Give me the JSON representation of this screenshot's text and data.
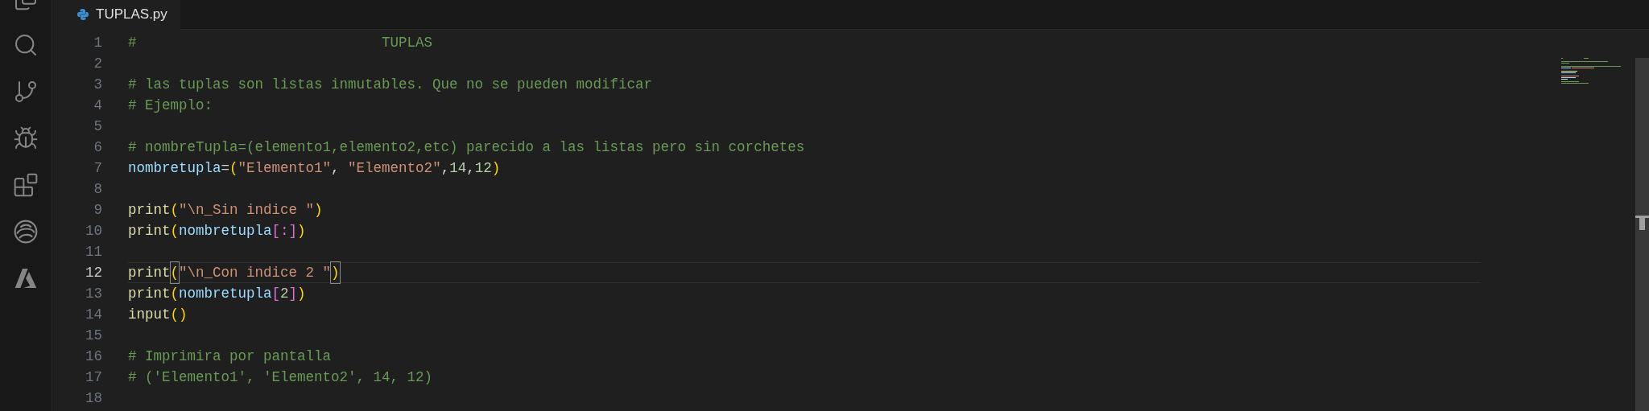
{
  "activity_bar": [
    {
      "kind": "files"
    },
    {
      "kind": "search"
    },
    {
      "kind": "source-control"
    },
    {
      "kind": "run-debug"
    },
    {
      "kind": "extensions"
    },
    {
      "kind": "swirl"
    },
    {
      "kind": "azure"
    }
  ],
  "tab": {
    "label": "TUPLAS.py",
    "selected": true
  },
  "lines": [
    {
      "number": "1",
      "selected": false,
      "tokens": [
        {
          "kind": "comment",
          "text": "#                             TUPLAS"
        }
      ]
    },
    {
      "number": "2",
      "selected": false
    },
    {
      "number": "3",
      "selected": false,
      "tokens": [
        {
          "kind": "comment",
          "text": "# las tuplas son listas inmutables. Que no se pueden modificar"
        }
      ]
    },
    {
      "number": "4",
      "selected": false,
      "tokens": [
        {
          "kind": "comment",
          "text": "# Ejemplo:"
        }
      ]
    },
    {
      "number": "5",
      "selected": false
    },
    {
      "number": "6",
      "selected": false,
      "tokens": [
        {
          "kind": "comment",
          "text": "# nombreTupla=(elemento1,elemento2,etc) parecido a las listas pero sin corchetes"
        }
      ]
    },
    {
      "number": "7",
      "selected": false,
      "tokens": [
        {
          "kind": "variable",
          "text": "nombretupla"
        },
        {
          "kind": "plain",
          "text": "="
        },
        {
          "kind": "bracket1",
          "text": "("
        },
        {
          "kind": "string",
          "text": "\"Elemento1\""
        },
        {
          "kind": "plain",
          "text": ", "
        },
        {
          "kind": "string",
          "text": "\"Elemento2\""
        },
        {
          "kind": "plain",
          "text": ","
        },
        {
          "kind": "number",
          "text": "14"
        },
        {
          "kind": "plain",
          "text": ","
        },
        {
          "kind": "number",
          "text": "12"
        },
        {
          "kind": "bracket1",
          "text": ")"
        }
      ]
    },
    {
      "number": "8",
      "selected": false
    },
    {
      "number": "9",
      "selected": false,
      "tokens": [
        {
          "kind": "function",
          "text": "print"
        },
        {
          "kind": "bracket1",
          "text": "("
        },
        {
          "kind": "string",
          "text": "\"\\n_Sin indice \""
        },
        {
          "kind": "bracket1",
          "text": ")"
        }
      ]
    },
    {
      "number": "10",
      "selected": false,
      "tokens": [
        {
          "kind": "function",
          "text": "print"
        },
        {
          "kind": "bracket1",
          "text": "("
        },
        {
          "kind": "variable",
          "text": "nombretupla"
        },
        {
          "kind": "bracket2",
          "text": "[:]"
        },
        {
          "kind": "bracket1",
          "text": ")"
        }
      ]
    },
    {
      "number": "11",
      "selected": false
    },
    {
      "number": "12",
      "selected": true,
      "tokens": [
        {
          "kind": "function",
          "text": "print"
        },
        {
          "kind": "matched",
          "text": "("
        },
        {
          "kind": "string",
          "text": "\"\\n_Con indice 2 \""
        },
        {
          "kind": "matched",
          "text": ")"
        }
      ]
    },
    {
      "number": "13",
      "selected": false,
      "tokens": [
        {
          "kind": "function",
          "text": "print"
        },
        {
          "kind": "bracket1",
          "text": "("
        },
        {
          "kind": "variable",
          "text": "nombretupla"
        },
        {
          "kind": "bracket2",
          "text": "["
        },
        {
          "kind": "number",
          "text": "2"
        },
        {
          "kind": "bracket2",
          "text": "]"
        },
        {
          "kind": "bracket1",
          "text": ")"
        }
      ]
    },
    {
      "number": "14",
      "selected": false,
      "tokens": [
        {
          "kind": "function",
          "text": "input"
        },
        {
          "kind": "bracket1",
          "text": "()"
        }
      ]
    },
    {
      "number": "15",
      "selected": false
    },
    {
      "number": "16",
      "selected": false,
      "tokens": [
        {
          "kind": "comment",
          "text": "# Imprimira por pantalla"
        }
      ]
    },
    {
      "number": "17",
      "selected": false,
      "tokens": [
        {
          "kind": "comment",
          "text": "# ('Elemento1', 'Elemento2', 14, 12)"
        }
      ]
    },
    {
      "number": "18",
      "selected": false
    }
  ]
}
